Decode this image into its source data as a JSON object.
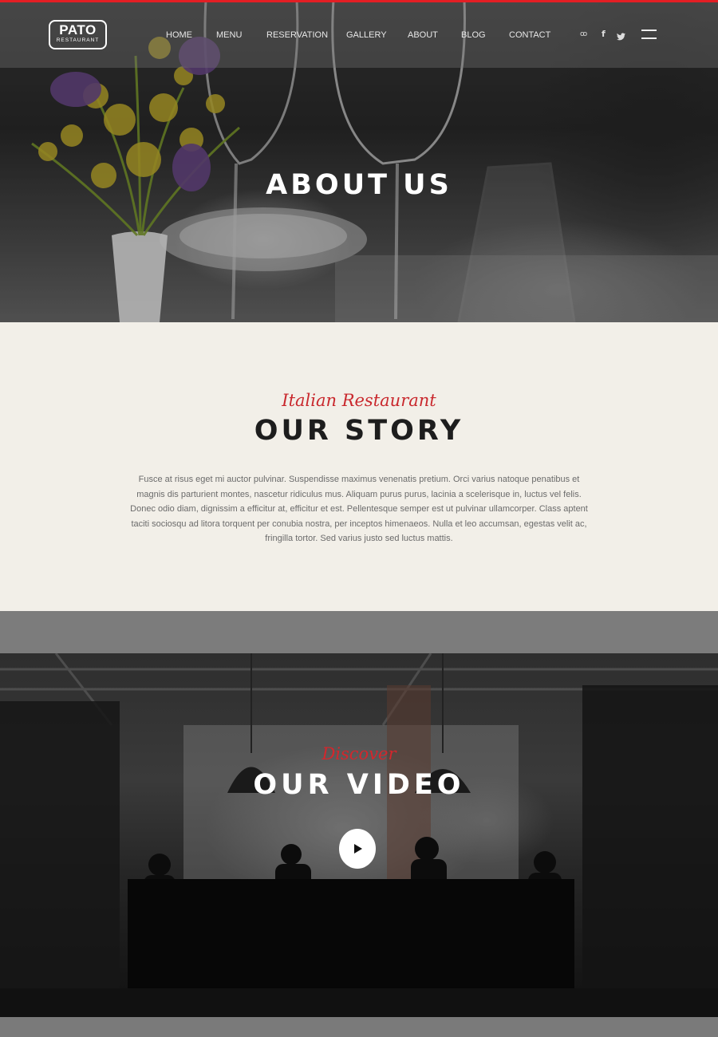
{
  "brand": {
    "name": "PATO",
    "tagline": "RESTAURANT"
  },
  "nav": {
    "items": [
      {
        "label": "HOME"
      },
      {
        "label": "MENU"
      },
      {
        "label": "RESERVATION"
      },
      {
        "label": "GALLERY"
      },
      {
        "label": "ABOUT"
      },
      {
        "label": "BLOG"
      },
      {
        "label": "CONTACT"
      }
    ],
    "social": [
      {
        "icon": "tripadvisor-icon",
        "glyph": "ꝏ"
      },
      {
        "icon": "facebook-icon",
        "glyph": "f"
      },
      {
        "icon": "twitter-icon",
        "glyph": "🐦"
      }
    ],
    "menu_icon": "hamburger-menu-icon"
  },
  "hero": {
    "title": "ABOUT US"
  },
  "story": {
    "kicker": "Italian Restaurant",
    "title": "OUR STORY",
    "body": "Fusce at risus eget mi auctor pulvinar. Suspendisse maximus venenatis pretium. Orci varius natoque penatibus et magnis dis parturient montes, nascetur ridiculus mus. Aliquam purus purus, lacinia a scelerisque in, luctus vel felis. Donec odio diam, dignissim a efficitur at, efficitur et est. Pellentesque semper est ut pulvinar ullamcorper. Class aptent taciti sociosqu ad litora torquent per conubia nostra, per inceptos himenaeos. Nulla et leo accumsan, egestas velit ac, fringilla tortor. Sed varius justo sed luctus mattis."
  },
  "video": {
    "kicker": "Discover",
    "title": "OUR VIDEO",
    "play_icon": "play-icon"
  },
  "colors": {
    "accent": "#e31e24",
    "script_red": "#c9282d",
    "story_bg": "#f2efe8",
    "dark_text": "#1d1d1d"
  }
}
